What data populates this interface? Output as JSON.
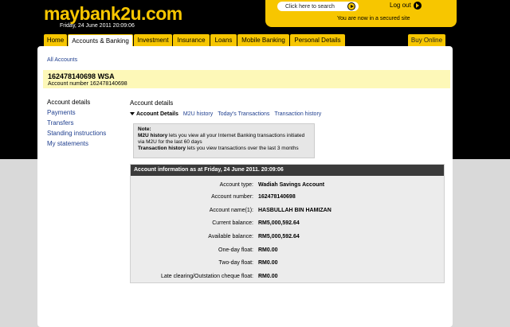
{
  "header": {
    "logo": "maybank2u.com",
    "datetime": "Friday, 24 June 2011 20:09:06",
    "search_label": "Click here to search",
    "logout_label": "Log out",
    "secure_text": "You are now in a secured site"
  },
  "tabs": [
    {
      "label": "Home"
    },
    {
      "label": "Accounts & Banking"
    },
    {
      "label": "Investment"
    },
    {
      "label": "Insurance"
    },
    {
      "label": "Loans"
    },
    {
      "label": "Mobile Banking"
    },
    {
      "label": "Personal Details"
    }
  ],
  "buy_online": "Buy Online",
  "breadcrumb": {
    "all_accounts": "All Accounts"
  },
  "account": {
    "title": "162478140698 WSA",
    "number_line": "Account number 162478140698"
  },
  "left_nav": [
    {
      "label": "Account details"
    },
    {
      "label": "Payments"
    },
    {
      "label": "Transfers"
    },
    {
      "label": "Standing instructions"
    },
    {
      "label": "My statements"
    }
  ],
  "content": {
    "section_title": "Account details",
    "subtabs": [
      {
        "label": "Account Details"
      },
      {
        "label": "M2U history"
      },
      {
        "label": "Today's Transactions"
      },
      {
        "label": "Transaction history"
      }
    ],
    "note": {
      "heading": "Note:",
      "m2u_term": "M2U history",
      "m2u_desc": " lets you view all your Internet Banking transactions initiated via M2U for the last 60 days",
      "txn_term": "Transaction history",
      "txn_desc": " lets you view transactions over the last 3 months"
    },
    "info_header": "Account information as at Friday, 24 June 2011. 20:09:06",
    "info_rows": [
      {
        "label": "Account type:",
        "value": "Wadiah Savings Account"
      },
      {
        "label": "Account number:",
        "value": "162478140698"
      },
      {
        "label": "Account name(1):",
        "value": "HASBULLAH BIN HAMIZAN"
      },
      {
        "label": "Current balance:",
        "value": "RM5,000,592.64"
      },
      {
        "label": "Available balance:",
        "value": "RM5,000,592.64"
      },
      {
        "label": "One-day float:",
        "value": "RM0.00"
      },
      {
        "label": "Two-day float:",
        "value": "RM0.00"
      },
      {
        "label": "Late clearing/Outstation cheque float:",
        "value": "RM0.00"
      }
    ]
  },
  "colors": {
    "brand_yellow": "#f7c600",
    "link_blue": "#1f3f8f",
    "banner_yellow": "#fdf8b8"
  }
}
